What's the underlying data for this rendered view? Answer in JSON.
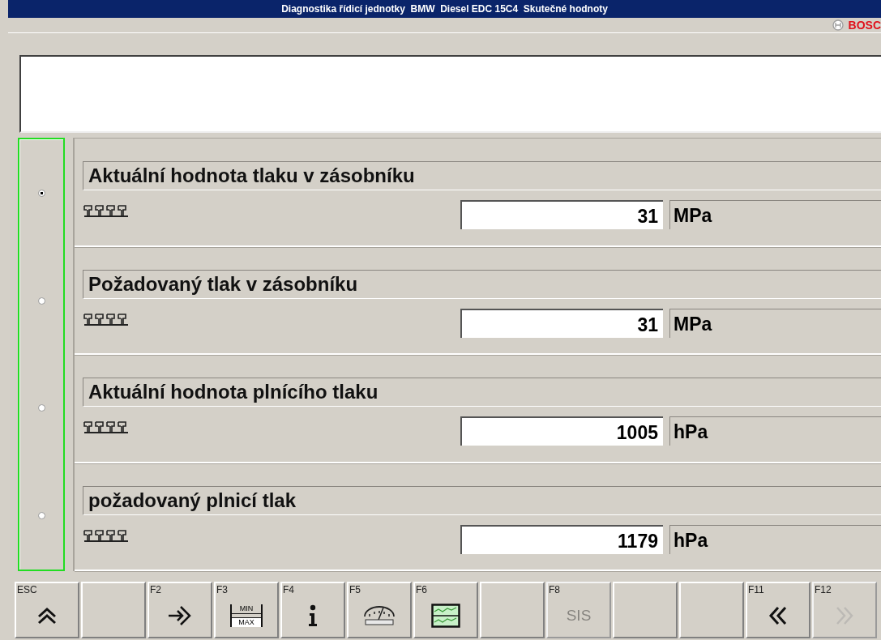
{
  "window": {
    "title": "Diagnostika řídicí jednotky  BMW  Diesel EDC 15C4  Skutečné hodnoty"
  },
  "brand": "BOSC",
  "rows": [
    {
      "label": "Aktuální hodnota tlaku v zásobníku",
      "value": "31",
      "unit": "MPa",
      "selected": true
    },
    {
      "label": "Požadovaný tlak v zásobníku",
      "value": "31",
      "unit": "MPa",
      "selected": false
    },
    {
      "label": "Aktuální hodnota plnícího tlaku",
      "value": "1005",
      "unit": "hPa",
      "selected": false
    },
    {
      "label": "požadovaný plnicí tlak",
      "value": "1179",
      "unit": "hPa",
      "selected": false
    }
  ],
  "keys": [
    {
      "key": "ESC",
      "kind": "up",
      "disabled": false
    },
    {
      "kind": "empty"
    },
    {
      "key": "F2",
      "kind": "enter",
      "disabled": false
    },
    {
      "key": "F3",
      "kind": "minmax",
      "min": "MIN",
      "max": "MAX",
      "disabled": false
    },
    {
      "key": "F4",
      "kind": "info",
      "disabled": false
    },
    {
      "key": "F5",
      "kind": "gauge",
      "disabled": false
    },
    {
      "key": "F6",
      "kind": "graph",
      "disabled": false
    },
    {
      "kind": "empty"
    },
    {
      "key": "F8",
      "kind": "text",
      "text": "SIS",
      "disabled": true
    },
    {
      "kind": "empty"
    },
    {
      "kind": "empty"
    },
    {
      "key": "F11",
      "kind": "back",
      "disabled": false
    },
    {
      "key": "F12",
      "kind": "forward",
      "disabled": true
    }
  ]
}
